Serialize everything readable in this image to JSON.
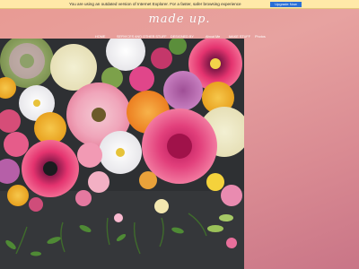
{
  "ie_notice": {
    "message": "You are using an outdated version of Internet Explorer. For a faster, safer browsing experience",
    "button_label": "Upgrade Now"
  },
  "logo": "made up.",
  "nav": [
    "HOME",
    "SERVICES AND OTHER STUFF",
    "DESIGNED BY",
    "About Me",
    "MAKE STUFF",
    "Photos"
  ],
  "hero": {
    "icon": "flower-bouquet-photo"
  }
}
